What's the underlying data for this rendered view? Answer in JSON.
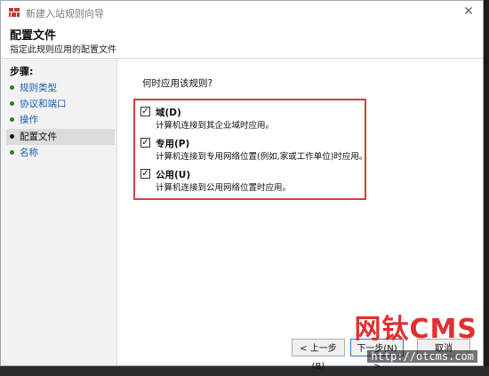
{
  "window": {
    "title": "新建入站规则向导",
    "close_label": "✕"
  },
  "header": {
    "title": "配置文件",
    "subtitle": "指定此规则应用的配置文件"
  },
  "steps": {
    "title": "步骤:",
    "items": [
      {
        "label": "规则类型",
        "current": false
      },
      {
        "label": "协议和端口",
        "current": false
      },
      {
        "label": "操作",
        "current": false
      },
      {
        "label": "配置文件",
        "current": true
      },
      {
        "label": "名称",
        "current": false
      }
    ]
  },
  "content": {
    "question": "何时应用该规则?",
    "options": [
      {
        "label": "域(D)",
        "checked": true,
        "description": "计算机连接到其企业域时应用。"
      },
      {
        "label": "专用(P)",
        "checked": true,
        "description": "计算机连接到专用网络位置(例如,家或工作单位)时应用。"
      },
      {
        "label": "公用(U)",
        "checked": true,
        "description": "计算机连接到公用网络位置时应用。"
      }
    ]
  },
  "buttons": {
    "back": "< 上一步(B)",
    "next": "下一步(N) >",
    "cancel": "取消"
  },
  "watermark": {
    "text": "网钛CMS",
    "url": "http://otcms.com"
  },
  "colors": {
    "highlight_border": "#d04040",
    "link": "#1a5fb4",
    "watermark": "#e03030"
  }
}
